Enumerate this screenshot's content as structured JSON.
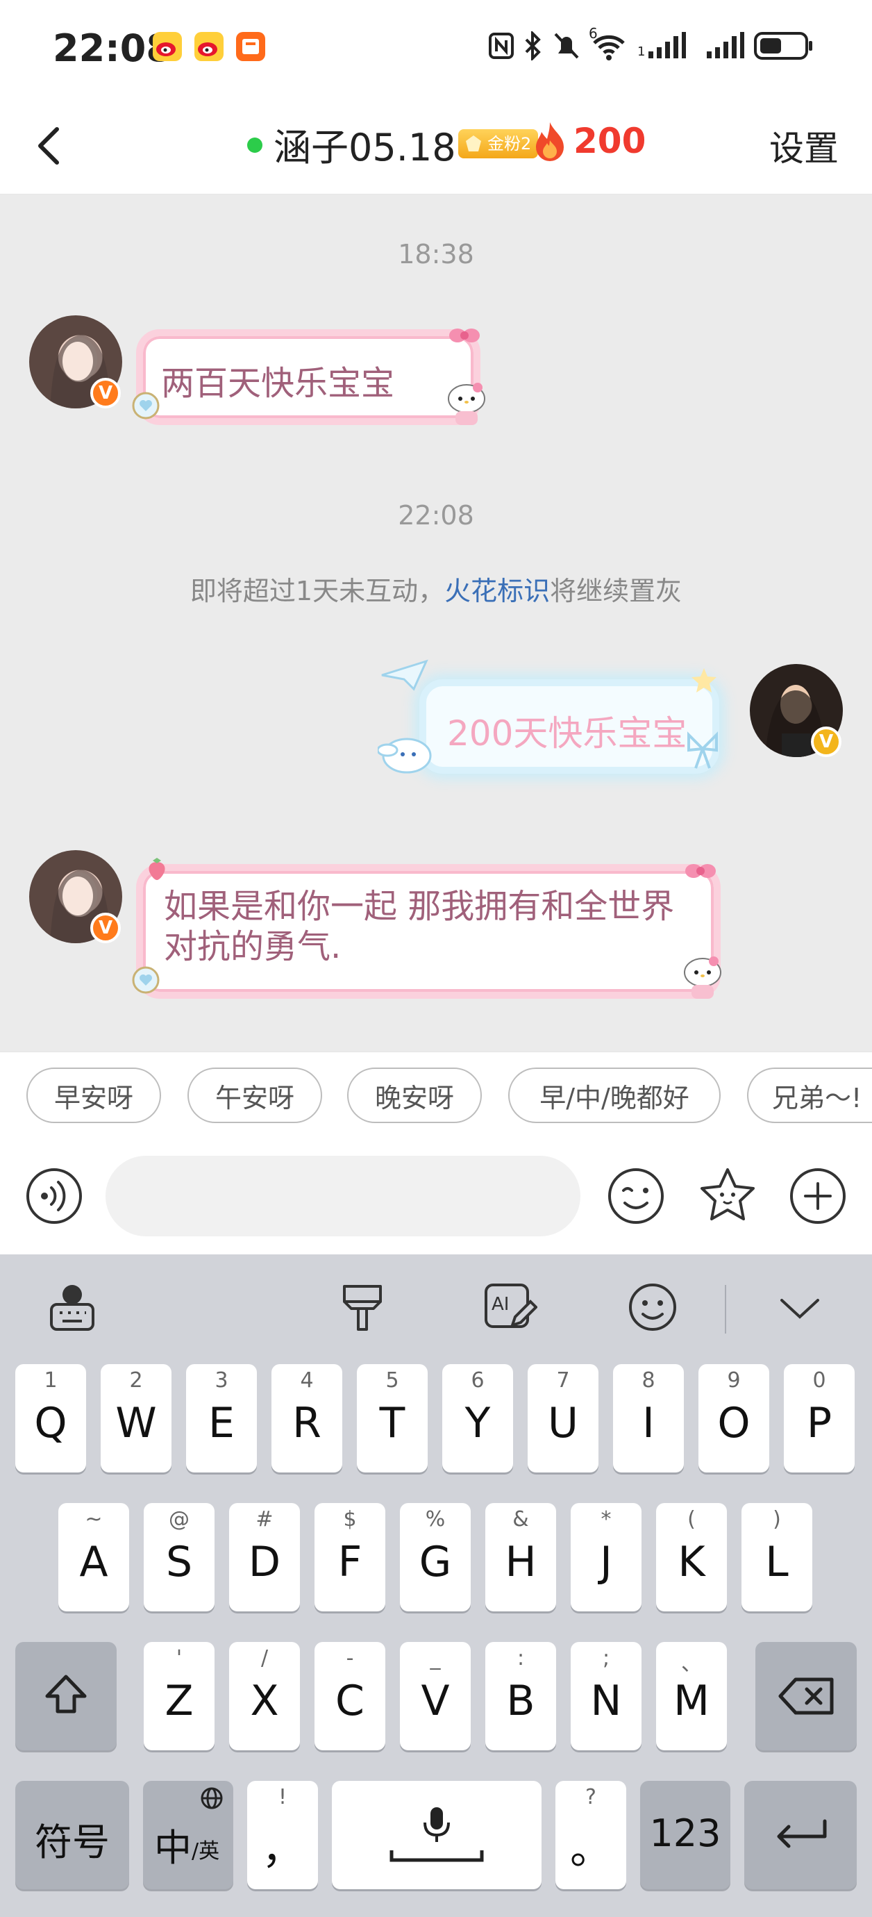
{
  "status_bar": {
    "time": "22:08",
    "app_icons": [
      "weibo-icon",
      "weibo-icon",
      "reading-app-icon"
    ],
    "icons": [
      "nfc-icon",
      "bluetooth-icon",
      "mute-icon",
      "wifi-6-icon",
      "signal-icon",
      "signal-icon",
      "battery-icon"
    ],
    "wifi_label": "6",
    "signal_sim_label": "1"
  },
  "header": {
    "back_icon": "chevron-left-icon",
    "online_color": "#2ccc4a",
    "title": "涵子05.18",
    "fan_badge": "金粉2",
    "flame_icon": "flame-icon",
    "flame_count": "200",
    "settings_label": "设置"
  },
  "chat": {
    "time_1": "18:38",
    "message_1": "两百天快乐宝宝",
    "time_2": "22:08",
    "notice_prefix": "即将超过1天未互动，",
    "notice_link": "火花标识",
    "notice_suffix": "将继续置灰",
    "message_2": "200天快乐宝宝",
    "message_3": "如果是和你一起 那我拥有和全世界对抗的勇气."
  },
  "quick_replies": [
    "早安呀",
    "午安呀",
    "晚安呀",
    "早/中/晚都好",
    "兄弟～!"
  ],
  "input_bar": {
    "voice_icon": "voice-icon",
    "placeholder": "",
    "emoji_icon": "wink-emoji-icon",
    "sticker_icon": "star-face-icon",
    "add_icon": "plus-circle-icon"
  },
  "keyboard": {
    "toolbar": [
      "globe-keyboard-icon",
      "brush-icon",
      "ai-write-icon",
      "emoji-icon",
      "chevron-down-icon"
    ],
    "row1": [
      {
        "hint": "1",
        "key": "Q"
      },
      {
        "hint": "2",
        "key": "W"
      },
      {
        "hint": "3",
        "key": "E"
      },
      {
        "hint": "4",
        "key": "R"
      },
      {
        "hint": "5",
        "key": "T"
      },
      {
        "hint": "6",
        "key": "Y"
      },
      {
        "hint": "7",
        "key": "U"
      },
      {
        "hint": "8",
        "key": "I"
      },
      {
        "hint": "9",
        "key": "O"
      },
      {
        "hint": "0",
        "key": "P"
      }
    ],
    "row2": [
      {
        "hint": "~",
        "key": "A"
      },
      {
        "hint": "@",
        "key": "S"
      },
      {
        "hint": "#",
        "key": "D"
      },
      {
        "hint": "$",
        "key": "F"
      },
      {
        "hint": "%",
        "key": "G"
      },
      {
        "hint": "&",
        "key": "H"
      },
      {
        "hint": "*",
        "key": "J"
      },
      {
        "hint": "(",
        "key": "K"
      },
      {
        "hint": ")",
        "key": "L"
      }
    ],
    "row3": [
      {
        "hint": "'",
        "key": "Z"
      },
      {
        "hint": "/",
        "key": "X"
      },
      {
        "hint": "-",
        "key": "C"
      },
      {
        "hint": "_",
        "key": "V"
      },
      {
        "hint": ":",
        "key": "B"
      },
      {
        "hint": ";",
        "key": "N"
      },
      {
        "hint": "、",
        "key": "M"
      }
    ],
    "shift_icon": "shift-icon",
    "delete_icon": "backspace-icon",
    "symbols_label": "符号",
    "lang_main": "中",
    "lang_sub": "/英",
    "comma_hint": "!",
    "comma_label": "，",
    "space_icon": "microphone-icon",
    "period_hint": "?",
    "period_label": "。",
    "numbers_label": "123",
    "enter_icon": "enter-icon"
  }
}
